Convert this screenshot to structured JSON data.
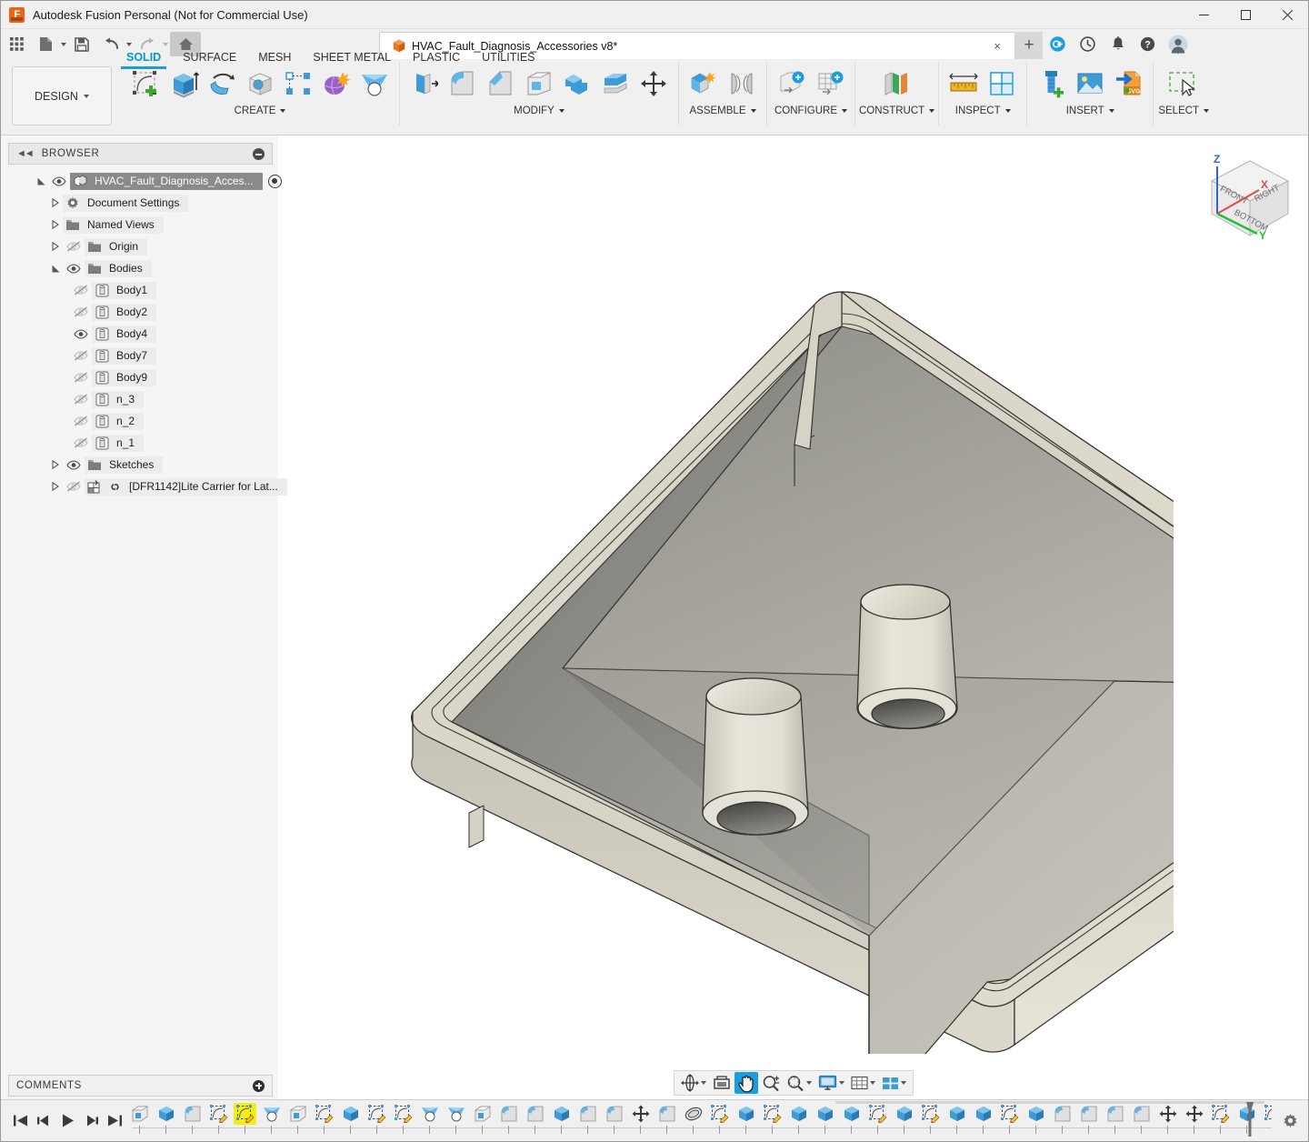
{
  "window": {
    "title": "Autodesk Fusion Personal (Not for Commercial Use)",
    "app_icon": "fusion-logo-icon",
    "controls": {
      "minimize": "minimize-icon",
      "maximize": "maximize-icon",
      "close": "close-icon"
    }
  },
  "quick_access": {
    "items": [
      {
        "name": "app-grid-button",
        "icon": "grid-apps-icon"
      },
      {
        "name": "new-document-button",
        "icon": "file-icon",
        "has_dropdown": true
      },
      {
        "name": "save-button",
        "icon": "floppy-disk-icon"
      },
      {
        "name": "undo-button",
        "icon": "undo-arrow-icon",
        "has_dropdown": true
      },
      {
        "name": "redo-button",
        "icon": "redo-arrow-icon",
        "has_dropdown": true
      },
      {
        "name": "home-button",
        "icon": "home-icon"
      }
    ]
  },
  "document_tab": {
    "label": "HVAC_Fault_Diagnosis_Accessories v8*",
    "icon": "orange-cube-icon",
    "close": "×",
    "new_tab": "+"
  },
  "top_right_icons": [
    {
      "name": "job-status-icon",
      "label": "job-status"
    },
    {
      "name": "recent-clock-icon",
      "label": "recent"
    },
    {
      "name": "notifications-bell-icon",
      "label": "notifications"
    },
    {
      "name": "help-question-icon",
      "label": "help"
    },
    {
      "name": "user-avatar-icon",
      "label": "account"
    }
  ],
  "ribbon": {
    "workspace": "DESIGN",
    "tabs": [
      {
        "label": "SOLID",
        "active": true
      },
      {
        "label": "SURFACE",
        "active": false
      },
      {
        "label": "MESH",
        "active": false
      },
      {
        "label": "SHEET METAL",
        "active": false
      },
      {
        "label": "PLASTIC",
        "active": false
      },
      {
        "label": "UTILITIES",
        "active": false
      }
    ],
    "panels": [
      {
        "label": "CREATE",
        "dropdown": true,
        "tools": [
          "create-sketch-icon",
          "extrude-icon",
          "revolve-icon",
          "hole-icon",
          "pattern-icon",
          "form-icon",
          "loft-icon"
        ]
      },
      {
        "label": "MODIFY",
        "dropdown": true,
        "tools": [
          "press-pull-icon",
          "fillet-icon",
          "chamfer-icon",
          "shell-icon",
          "combine-icon",
          "offset-face-icon",
          "move-copy-icon"
        ]
      },
      {
        "label": "ASSEMBLE",
        "dropdown": true,
        "tools": [
          "new-component-icon",
          "joint-icon"
        ]
      },
      {
        "label": "CONFIGURE",
        "dropdown": true,
        "tools": [
          "configuration-icon",
          "configuration-table-icon"
        ]
      },
      {
        "label": "CONSTRUCT",
        "dropdown": true,
        "tools": [
          "offset-plane-icon"
        ]
      },
      {
        "label": "INSPECT",
        "dropdown": true,
        "tools": [
          "measure-icon",
          "section-analysis-icon"
        ]
      },
      {
        "label": "INSERT",
        "dropdown": true,
        "tools": [
          "insert-mcmaster-icon",
          "insert-canvas-icon",
          "insert-svg-icon"
        ]
      },
      {
        "label": "SELECT",
        "dropdown": true,
        "tools": [
          "select-window-icon"
        ]
      }
    ]
  },
  "browser": {
    "title": "BROWSER",
    "collapse_icon": "collapse-left-icon",
    "minimize_icon": "minus-circle-icon",
    "tree": [
      {
        "label": "HVAC_Fault_Diagnosis_Acces...",
        "indent": 0,
        "twisty": "expanded",
        "visible": true,
        "icon": "component-icon",
        "selected": true,
        "radio": true
      },
      {
        "label": "Document Settings",
        "indent": 1,
        "twisty": "collapsed",
        "visible": null,
        "icon": "gear-icon",
        "selected": false
      },
      {
        "label": "Named Views",
        "indent": 1,
        "twisty": "collapsed",
        "visible": null,
        "icon": "folder-icon",
        "selected": false
      },
      {
        "label": "Origin",
        "indent": 1,
        "twisty": "collapsed",
        "visible": false,
        "icon": "folder-icon",
        "selected": false
      },
      {
        "label": "Bodies",
        "indent": 1,
        "twisty": "expanded",
        "visible": true,
        "icon": "folder-icon",
        "selected": false
      },
      {
        "label": "Body1",
        "indent": 2,
        "twisty": "none",
        "visible": false,
        "icon": "body-icon",
        "selected": false
      },
      {
        "label": "Body2",
        "indent": 2,
        "twisty": "none",
        "visible": false,
        "icon": "body-icon",
        "selected": false
      },
      {
        "label": "Body4",
        "indent": 2,
        "twisty": "none",
        "visible": true,
        "icon": "body-icon",
        "selected": false
      },
      {
        "label": "Body7",
        "indent": 2,
        "twisty": "none",
        "visible": false,
        "icon": "body-icon",
        "selected": false
      },
      {
        "label": "Body9",
        "indent": 2,
        "twisty": "none",
        "visible": false,
        "icon": "body-icon",
        "selected": false
      },
      {
        "label": "n_3",
        "indent": 2,
        "twisty": "none",
        "visible": false,
        "icon": "body-icon",
        "selected": false
      },
      {
        "label": "n_2",
        "indent": 2,
        "twisty": "none",
        "visible": false,
        "icon": "body-icon",
        "selected": false
      },
      {
        "label": "n_1",
        "indent": 2,
        "twisty": "none",
        "visible": false,
        "icon": "body-icon",
        "selected": false
      },
      {
        "label": "Sketches",
        "indent": 1,
        "twisty": "collapsed",
        "visible": true,
        "icon": "folder-icon",
        "selected": false
      },
      {
        "label": "[DFR1142]Lite Carrier for Lat...",
        "indent": 1,
        "twisty": "collapsed",
        "visible": false,
        "icon": "linked-component-icon",
        "selected": false,
        "link": true
      }
    ]
  },
  "viewcube": {
    "faces": [
      "FRONT",
      "RIGHT",
      "BOTTOM"
    ],
    "axes": [
      {
        "label": "Z",
        "color": "#3a5fd0"
      },
      {
        "label": "X",
        "color": "#e04a4a"
      },
      {
        "label": "Y",
        "color": "#1fc22a"
      }
    ]
  },
  "model": {
    "description": "Tapered square HVAC drain pan with two conical outlet spouts",
    "colors": {
      "top_light": "#ddd9cc",
      "top_mid": "#d2cfc2",
      "interior_dark": "#8d8c86",
      "interior_mid": "#a9a7a0",
      "edge": "#3b3b3b"
    }
  },
  "comments": {
    "title": "COMMENTS",
    "add_icon": "plus-circle-icon"
  },
  "navbar": {
    "items": [
      {
        "name": "orbit-button",
        "icon": "orbit-icon",
        "dropdown": true,
        "active": false
      },
      {
        "name": "look-at-button",
        "icon": "look-at-icon",
        "dropdown": false,
        "active": false
      },
      {
        "name": "pan-button",
        "icon": "hand-pan-icon",
        "dropdown": false,
        "active": true
      },
      {
        "name": "zoom-button",
        "icon": "magnifier-plusminus-icon",
        "dropdown": false,
        "active": false
      },
      {
        "name": "fit-button",
        "icon": "zoom-fit-icon",
        "dropdown": true,
        "active": false
      },
      {
        "name": "display-settings-button",
        "icon": "monitor-icon",
        "dropdown": true,
        "active": false
      },
      {
        "name": "grid-snaps-button",
        "icon": "grid-icon",
        "dropdown": true,
        "active": false
      },
      {
        "name": "viewports-button",
        "icon": "viewport-layout-icon",
        "dropdown": true,
        "active": false
      }
    ]
  },
  "timeline": {
    "playback": [
      "skip-to-start-icon",
      "step-back-icon",
      "play-icon",
      "step-forward-icon",
      "skip-to-end-icon"
    ],
    "features": [
      {
        "icon": "shell-icon",
        "highlighted": false
      },
      {
        "icon": "extrude-icon",
        "highlighted": false
      },
      {
        "icon": "fillet-icon",
        "highlighted": false
      },
      {
        "icon": "sketch-icon",
        "highlighted": false
      },
      {
        "icon": "sketch-icon",
        "highlighted": true
      },
      {
        "icon": "loft-icon",
        "highlighted": false
      },
      {
        "icon": "shell-icon",
        "highlighted": false
      },
      {
        "icon": "sketch-icon",
        "highlighted": false
      },
      {
        "icon": "extrude-icon",
        "highlighted": false
      },
      {
        "icon": "sketch-icon",
        "highlighted": false
      },
      {
        "icon": "sketch-icon",
        "highlighted": false
      },
      {
        "icon": "loft-icon",
        "highlighted": false
      },
      {
        "icon": "loft-icon",
        "highlighted": false
      },
      {
        "icon": "shell-icon",
        "highlighted": false
      },
      {
        "icon": "fillet-icon",
        "highlighted": false
      },
      {
        "icon": "fillet-icon",
        "highlighted": false
      },
      {
        "icon": "extrude-icon",
        "highlighted": false
      },
      {
        "icon": "fillet-icon",
        "highlighted": false
      },
      {
        "icon": "fillet-icon",
        "highlighted": false
      },
      {
        "icon": "move-copy-icon",
        "highlighted": false
      },
      {
        "icon": "fillet-icon",
        "highlighted": false
      },
      {
        "icon": "combine-icon",
        "highlighted": false
      },
      {
        "icon": "sketch-icon",
        "highlighted": false
      },
      {
        "icon": "extrude-icon",
        "highlighted": false
      },
      {
        "icon": "sketch-icon",
        "highlighted": false
      },
      {
        "icon": "extrude-icon",
        "highlighted": false
      },
      {
        "icon": "extrude-icon",
        "highlighted": false
      },
      {
        "icon": "extrude-icon",
        "highlighted": false
      },
      {
        "icon": "sketch-icon",
        "highlighted": false
      },
      {
        "icon": "extrude-icon",
        "highlighted": false
      },
      {
        "icon": "sketch-icon",
        "highlighted": false
      },
      {
        "icon": "extrude-icon",
        "highlighted": false
      },
      {
        "icon": "extrude-icon",
        "highlighted": false
      },
      {
        "icon": "sketch-icon",
        "highlighted": false
      },
      {
        "icon": "extrude-icon",
        "highlighted": false
      },
      {
        "icon": "fillet-icon",
        "highlighted": false
      },
      {
        "icon": "fillet-icon",
        "highlighted": false
      },
      {
        "icon": "fillet-icon",
        "highlighted": false
      },
      {
        "icon": "fillet-icon",
        "highlighted": false
      },
      {
        "icon": "move-copy-icon",
        "highlighted": false
      },
      {
        "icon": "move-copy-icon",
        "highlighted": false
      },
      {
        "icon": "sketch-icon",
        "highlighted": false
      },
      {
        "icon": "extrude-icon",
        "highlighted": false
      },
      {
        "icon": "sketch-icon",
        "highlighted": false
      },
      {
        "icon": "extrude-icon",
        "highlighted": false
      }
    ],
    "settings_icon": "gear-icon"
  }
}
